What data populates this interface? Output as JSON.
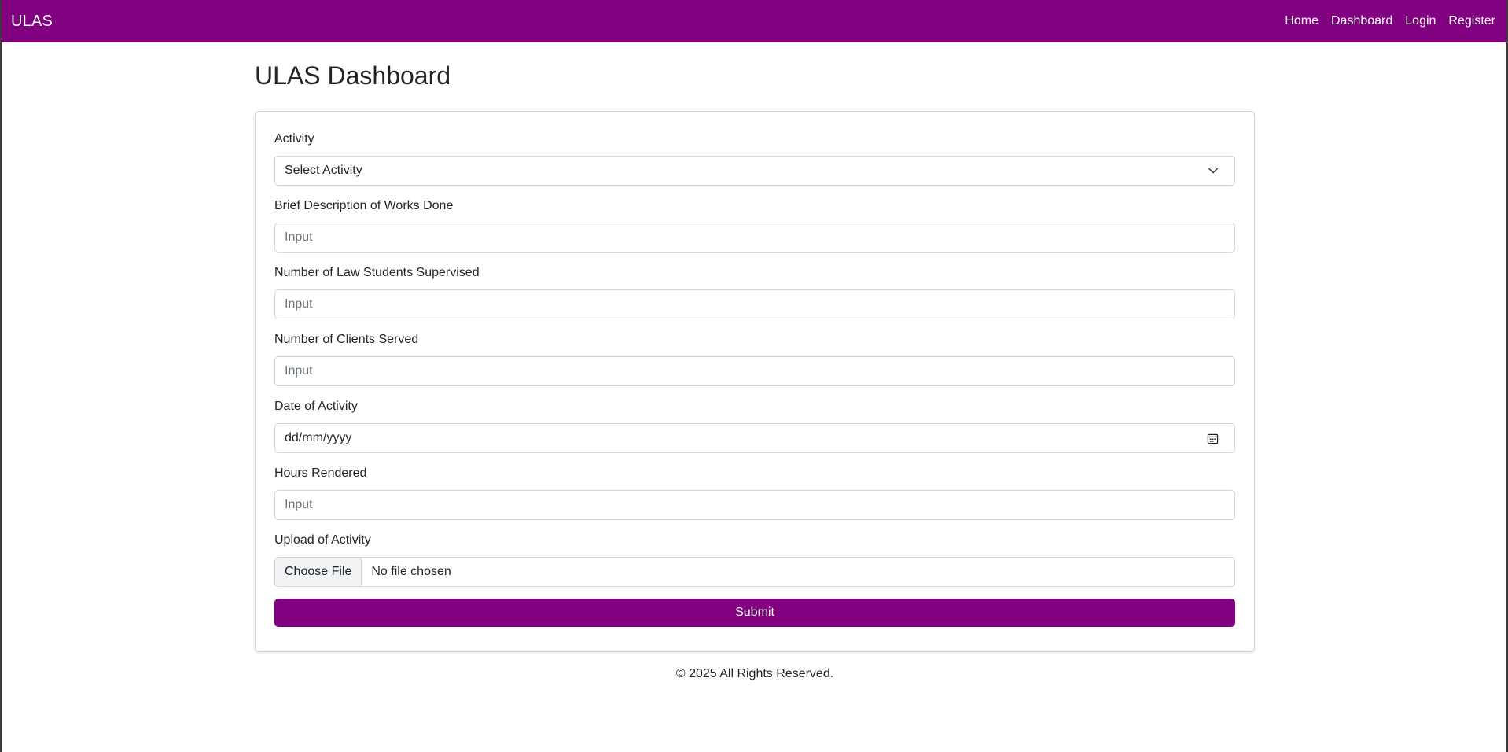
{
  "navbar": {
    "brand": "ULAS",
    "links": [
      "Home",
      "Dashboard",
      "Login",
      "Register"
    ],
    "color": "#800080"
  },
  "page": {
    "title": "ULAS Dashboard"
  },
  "form": {
    "activity": {
      "label": "Activity",
      "selected": "Select Activity",
      "icon": "chevron-down-icon"
    },
    "description": {
      "label": "Brief Description of Works Done",
      "placeholder": "Input",
      "value": ""
    },
    "students_supervised": {
      "label": "Number of Law Students Supervised",
      "placeholder": "Input",
      "value": ""
    },
    "clients_served": {
      "label": "Number of Clients Served",
      "placeholder": "Input",
      "value": ""
    },
    "date": {
      "label": "Date of Activity",
      "value": "dd/mm/yyyy",
      "icon": "calendar-icon"
    },
    "hours": {
      "label": "Hours Rendered",
      "placeholder": "Input",
      "value": ""
    },
    "upload": {
      "label": "Upload of Activity",
      "button_label": "Choose File",
      "status": "No file chosen"
    },
    "submit_label": "Submit"
  },
  "footer": {
    "text": "© 2025 All Rights Reserved."
  }
}
